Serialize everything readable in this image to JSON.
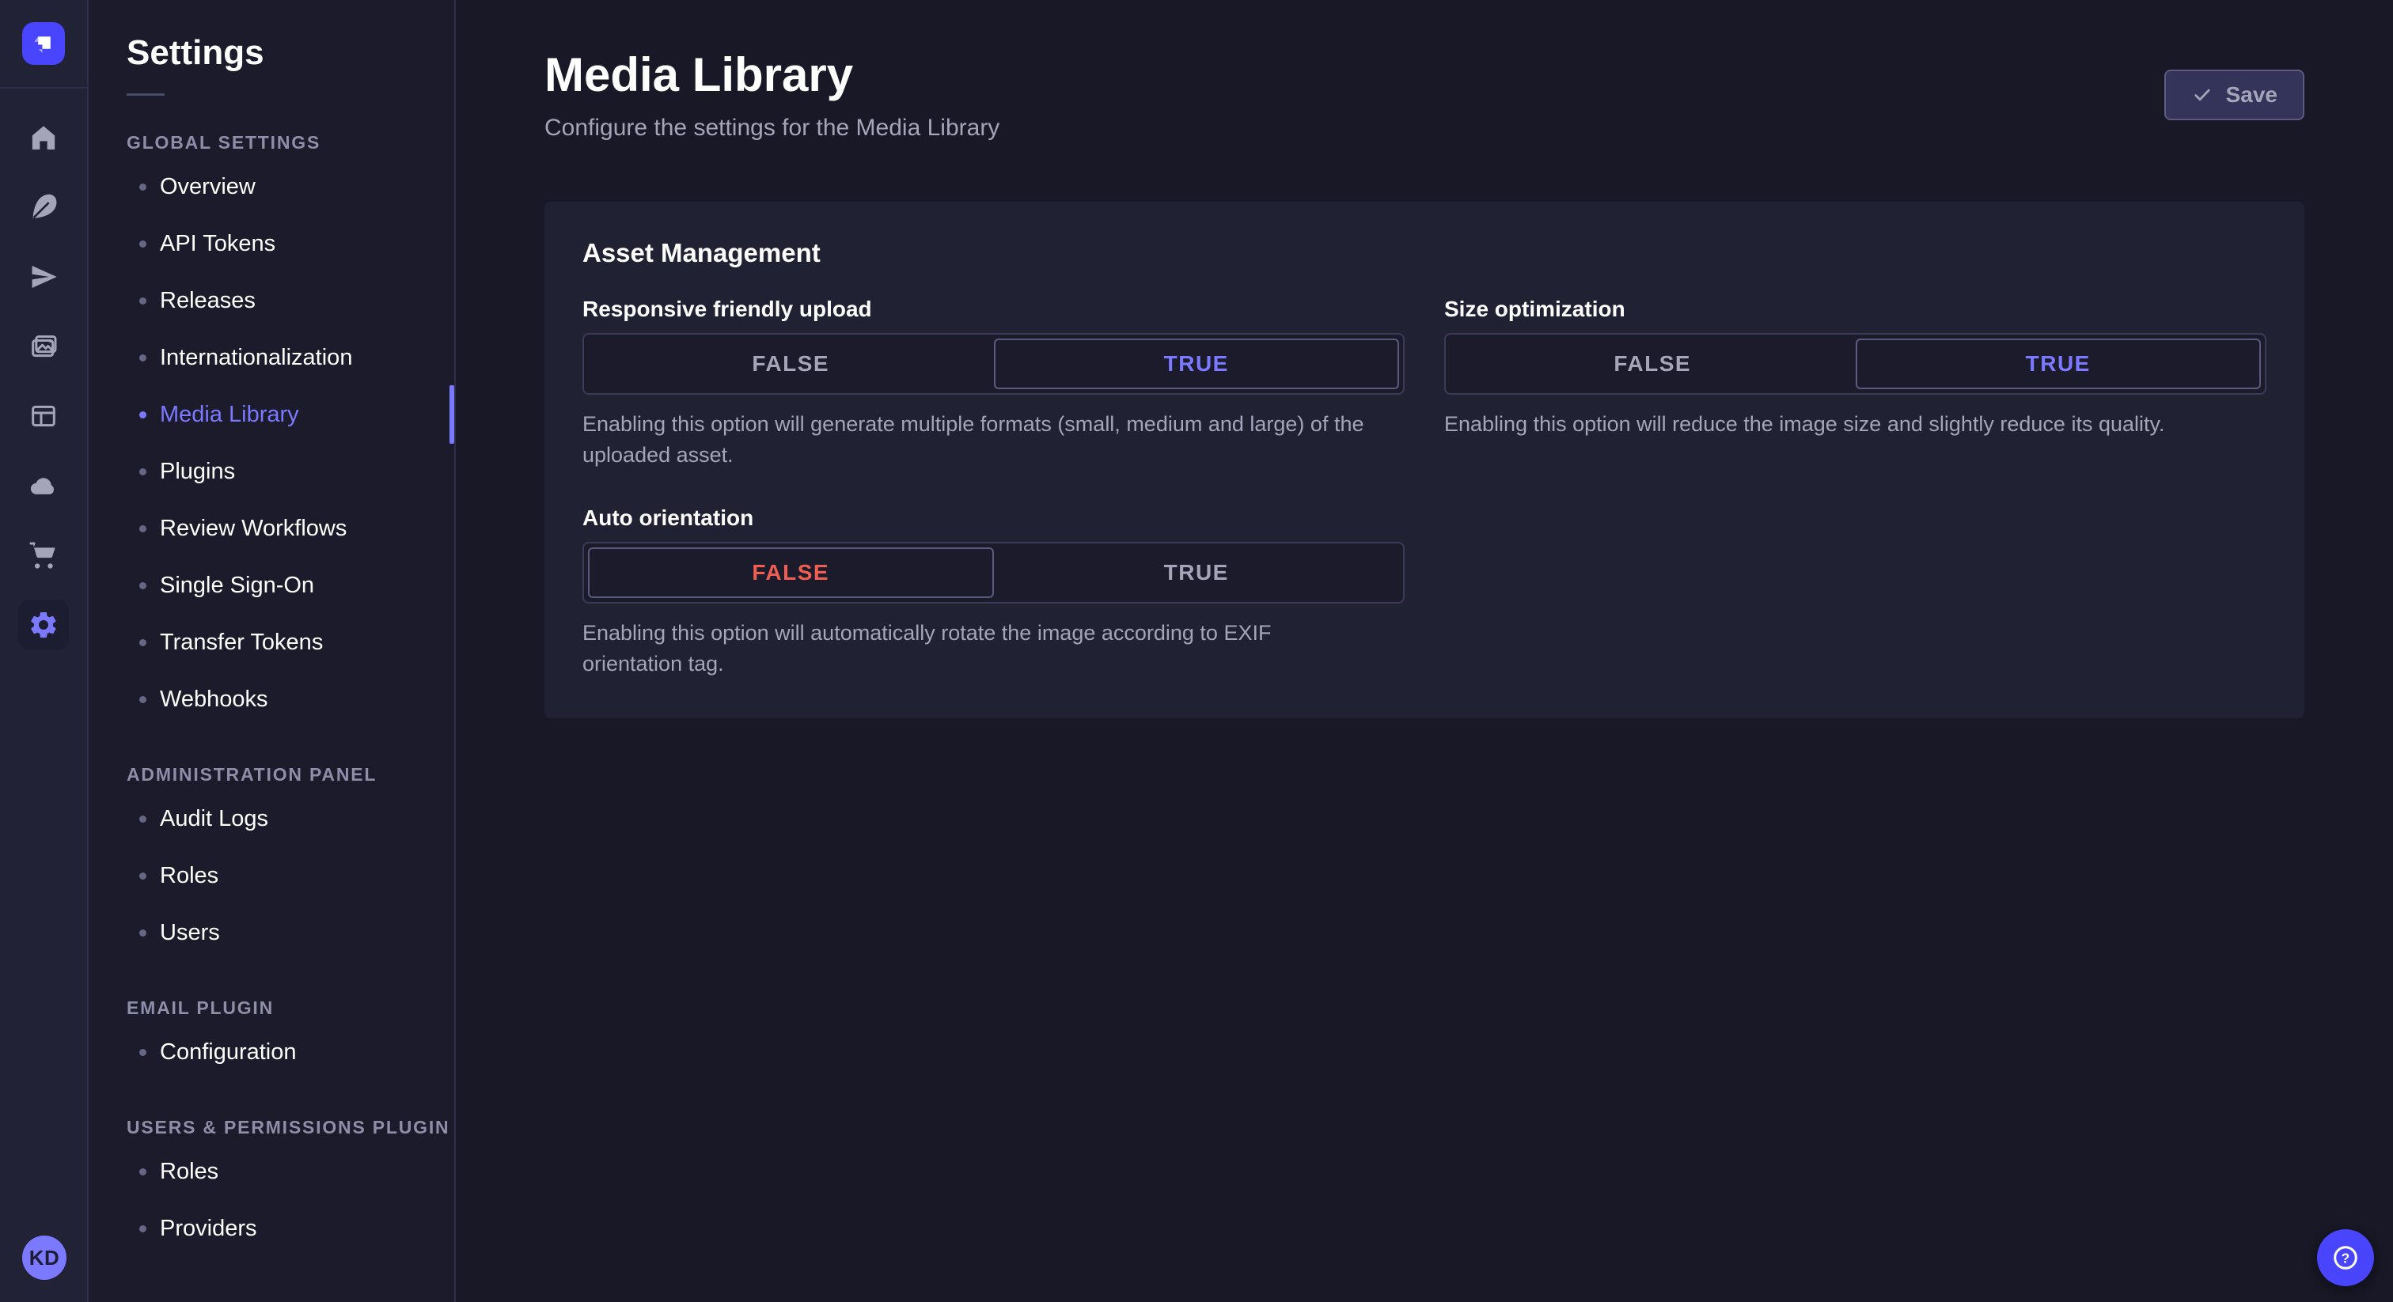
{
  "app": {
    "logo_icon": "strapi-logo-icon",
    "colors": {
      "accent": "#7b79ff",
      "primary": "#4945ff",
      "danger": "#ee5e52",
      "page_bg": "#181826",
      "card_bg": "#212134"
    }
  },
  "icon_rail": {
    "icons": [
      "home-icon",
      "feather-icon",
      "paper-plane-icon",
      "images-icon",
      "layout-icon",
      "cloud-icon",
      "cart-icon",
      "gear-icon"
    ],
    "active_icon": "gear-icon",
    "avatar_initials": "KD"
  },
  "subnav": {
    "title": "Settings",
    "sections": [
      {
        "label": "GLOBAL SETTINGS",
        "items": [
          {
            "label": "Overview",
            "active": false
          },
          {
            "label": "API Tokens",
            "active": false
          },
          {
            "label": "Releases",
            "active": false
          },
          {
            "label": "Internationalization",
            "active": false
          },
          {
            "label": "Media Library",
            "active": true
          },
          {
            "label": "Plugins",
            "active": false
          },
          {
            "label": "Review Workflows",
            "active": false
          },
          {
            "label": "Single Sign-On",
            "active": false
          },
          {
            "label": "Transfer Tokens",
            "active": false
          },
          {
            "label": "Webhooks",
            "active": false
          }
        ]
      },
      {
        "label": "ADMINISTRATION PANEL",
        "items": [
          {
            "label": "Audit Logs",
            "active": false
          },
          {
            "label": "Roles",
            "active": false
          },
          {
            "label": "Users",
            "active": false
          }
        ]
      },
      {
        "label": "EMAIL PLUGIN",
        "items": [
          {
            "label": "Configuration",
            "active": false
          }
        ]
      },
      {
        "label": "USERS & PERMISSIONS PLUGIN",
        "items": [
          {
            "label": "Roles",
            "active": false
          },
          {
            "label": "Providers",
            "active": false
          }
        ]
      }
    ]
  },
  "header": {
    "title": "Media Library",
    "subtitle": "Configure the settings for the Media Library",
    "save_label": "Save"
  },
  "card": {
    "title": "Asset Management",
    "fields": [
      {
        "label": "Responsive friendly upload",
        "options": [
          "FALSE",
          "TRUE"
        ],
        "value": "TRUE",
        "hint": "Enabling this option will generate multiple formats (small, medium and large) of the uploaded asset."
      },
      {
        "label": "Size optimization",
        "options": [
          "FALSE",
          "TRUE"
        ],
        "value": "TRUE",
        "hint": "Enabling this option will reduce the image size and slightly reduce its quality."
      },
      {
        "label": "Auto orientation",
        "options": [
          "FALSE",
          "TRUE"
        ],
        "value": "FALSE",
        "hint": "Enabling this option will automatically rotate the image according to EXIF orientation tag."
      }
    ]
  },
  "help": {
    "icon": "question-icon"
  }
}
